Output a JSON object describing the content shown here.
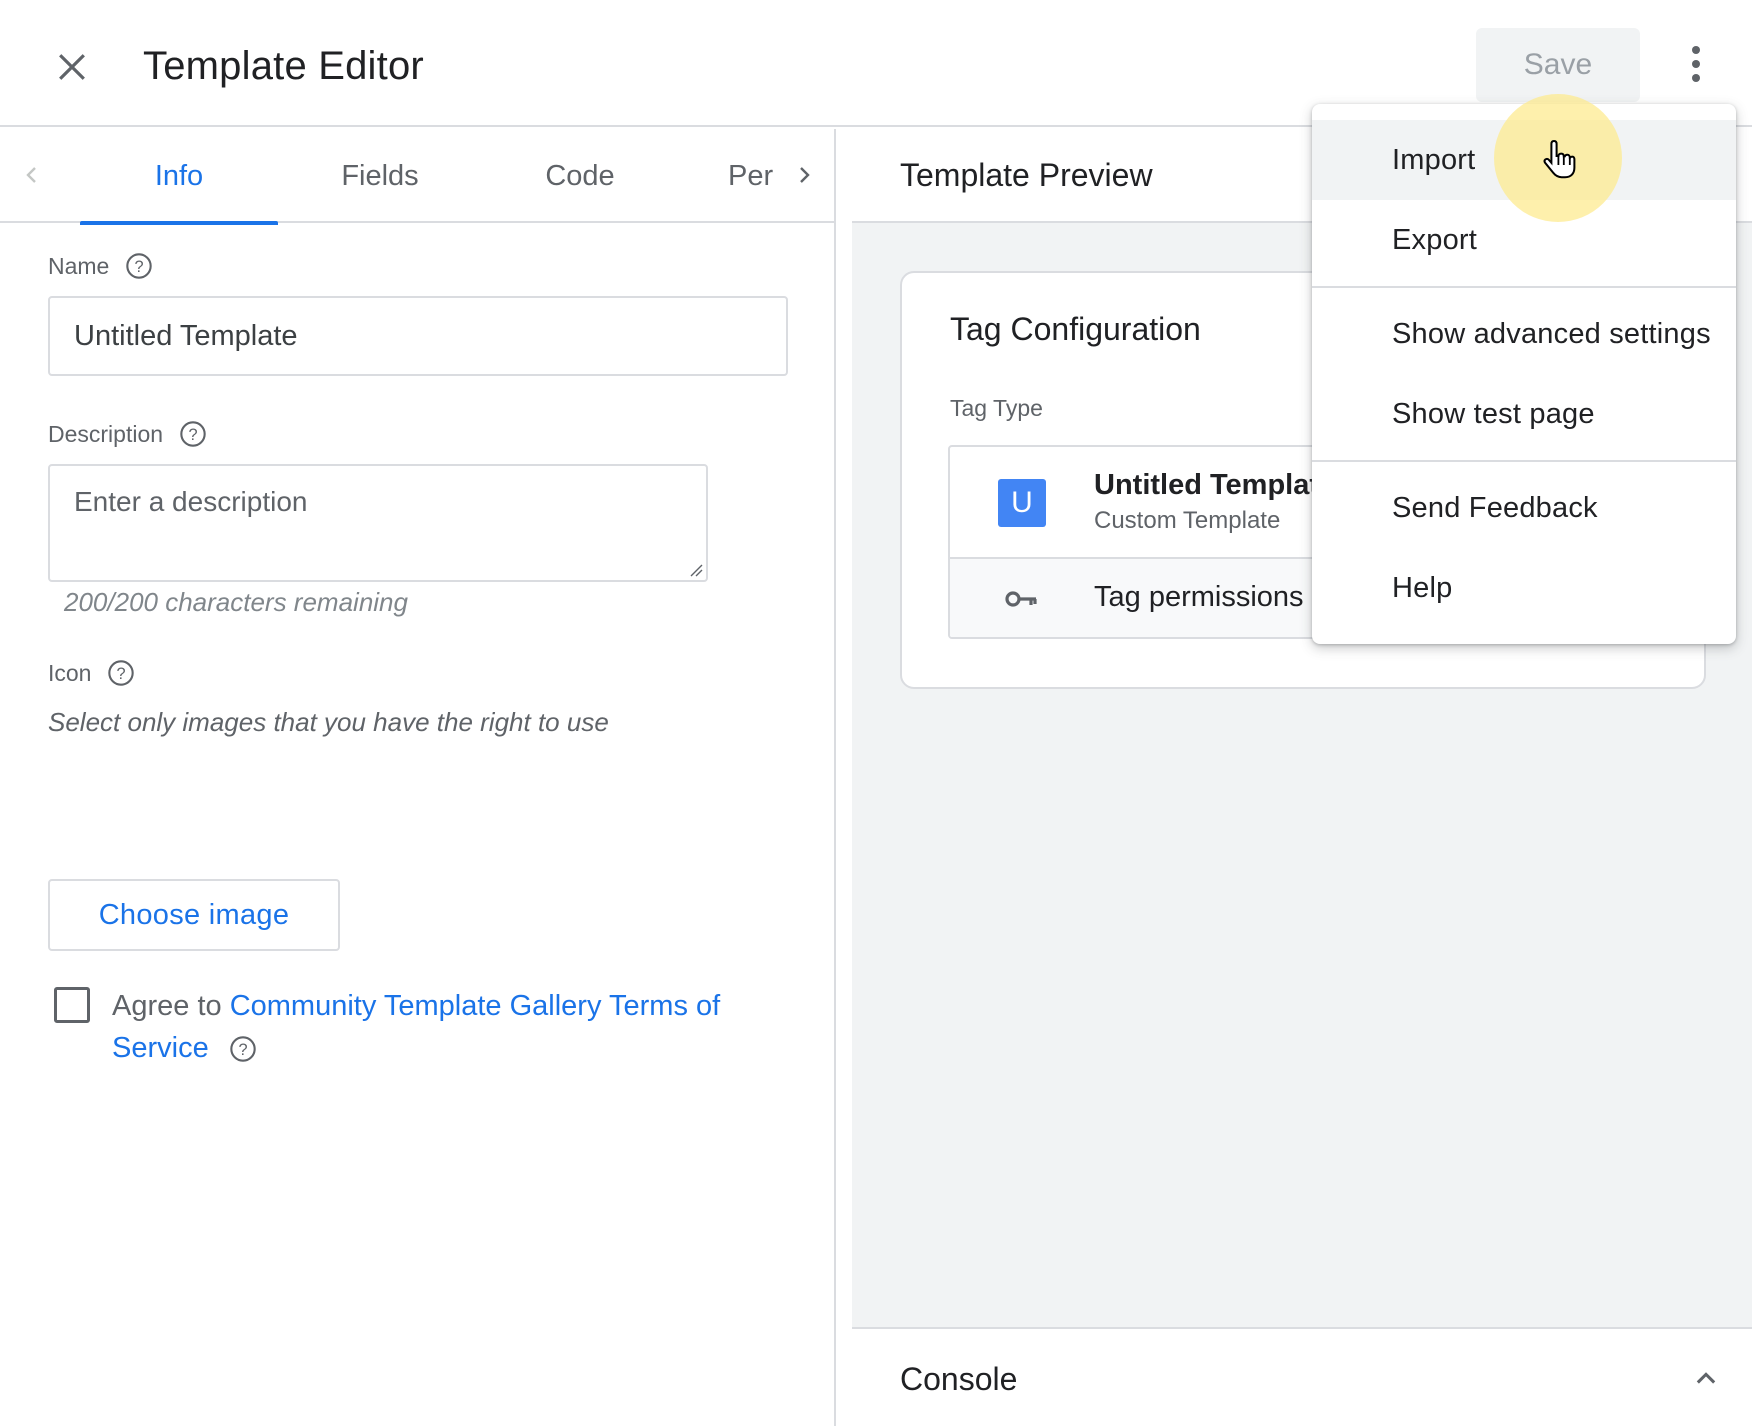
{
  "header": {
    "title": "Template Editor",
    "save_label": "Save"
  },
  "tabs": [
    {
      "label": "Info",
      "active": true
    },
    {
      "label": "Fields",
      "active": false
    },
    {
      "label": "Code",
      "active": false
    },
    {
      "label": "Per",
      "active": false
    }
  ],
  "info": {
    "name_label": "Name",
    "name_value": "Untitled Template",
    "description_label": "Description",
    "description_placeholder": "Enter a description",
    "description_counter": "200/200 characters remaining",
    "icon_label": "Icon",
    "icon_hint": "Select only images that you have the right to use",
    "choose_image_label": "Choose image",
    "agree_prefix": "Agree to",
    "agree_link": "Community Template Gallery Terms of Service",
    "agree_checked": false
  },
  "preview": {
    "title": "Template Preview",
    "card_title": "Tag Configuration",
    "tag_type_label": "Tag Type",
    "tag_icon_letter": "U",
    "tag_name": "Untitled Template",
    "tag_subtitle": "Custom Template",
    "permissions_label": "Tag permissions",
    "console_label": "Console"
  },
  "menu": {
    "items": [
      {
        "label": "Import",
        "hovered": true
      },
      {
        "label": "Export"
      },
      {
        "label": "Show advanced settings"
      },
      {
        "label": "Show test page"
      },
      {
        "label": "Send Feedback"
      },
      {
        "label": "Help"
      }
    ]
  },
  "colors": {
    "accent": "#1a73e8",
    "tag_icon_bg": "#4285f4",
    "panel_bg": "#f1f3f4",
    "cursor_highlight": "#fdea8c"
  },
  "icons": {
    "close": "close-icon",
    "more": "more-vert-icon",
    "help": "help-circle-icon",
    "key": "key-icon",
    "chevron_left": "chevron-left-icon",
    "chevron_right": "chevron-right-icon",
    "chevron_up": "chevron-up-icon",
    "cursor": "hand-pointer-icon"
  }
}
